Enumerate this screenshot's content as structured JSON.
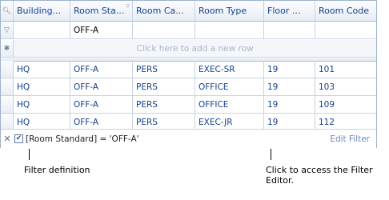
{
  "grid": {
    "columns": [
      "Building...",
      "Room Sta...",
      "Room Ca...",
      "Room Type",
      "Floor ...",
      "Room Code"
    ],
    "filter_row": [
      "",
      "OFF-A",
      "",
      "",
      "",
      ""
    ],
    "new_row_text": "Click here to add a new row",
    "rows": [
      [
        "HQ",
        "OFF-A",
        "PERS",
        "EXEC-SR",
        "19",
        "101"
      ],
      [
        "HQ",
        "OFF-A",
        "PERS",
        "OFFICE",
        "19",
        "103"
      ],
      [
        "HQ",
        "OFF-A",
        "PERS",
        "OFFICE",
        "19",
        "109"
      ],
      [
        "HQ",
        "OFF-A",
        "PERS",
        "EXEC-JR",
        "19",
        "112"
      ]
    ]
  },
  "filter_panel": {
    "enabled": true,
    "expression": "[Room Standard] = 'OFF-A'",
    "edit_label": "Edit Filter"
  },
  "callouts": {
    "filter_definition": "Filter definition",
    "editor_line1": "Click to access the Filter",
    "editor_line2": "Editor."
  }
}
